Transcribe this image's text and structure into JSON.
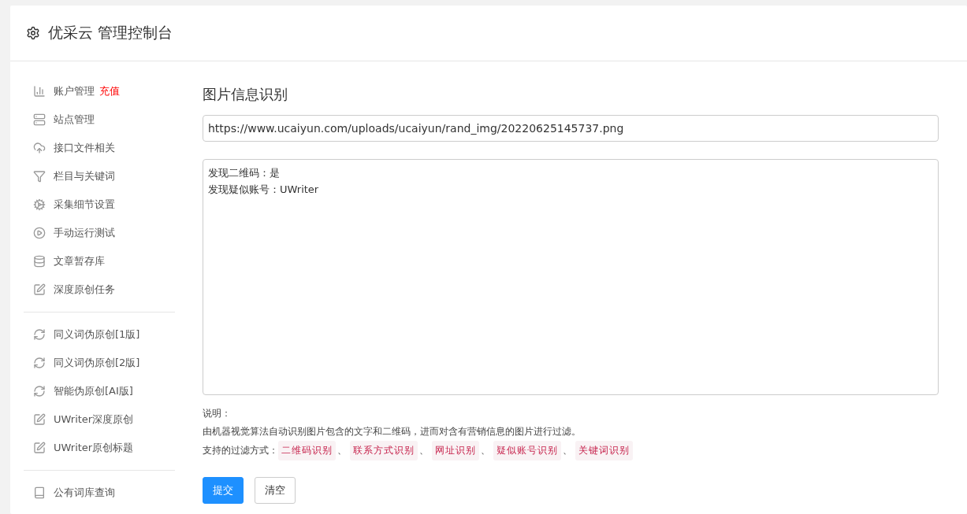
{
  "header": {
    "title": "优采云 管理控制台"
  },
  "sidebar": {
    "groups": [
      {
        "items": [
          {
            "kind": "chart",
            "label": "账户管理",
            "badge": "充值"
          },
          {
            "kind": "server",
            "label": "站点管理"
          },
          {
            "kind": "upload",
            "label": "接口文件相关"
          },
          {
            "kind": "filter",
            "label": "栏目与关键词"
          },
          {
            "kind": "cogs",
            "label": "采集细节设置"
          },
          {
            "kind": "play",
            "label": "手动运行测试"
          },
          {
            "kind": "database",
            "label": "文章暂存库"
          },
          {
            "kind": "edit",
            "label": "深度原创任务"
          }
        ]
      },
      {
        "items": [
          {
            "kind": "refresh",
            "label": "同义词伪原创[1版]"
          },
          {
            "kind": "refresh",
            "label": "同义词伪原创[2版]"
          },
          {
            "kind": "refresh",
            "label": "智能伪原创[AI版]"
          },
          {
            "kind": "edit",
            "label": "UWriter深度原创"
          },
          {
            "kind": "edit",
            "label": "UWriter原创标题"
          }
        ]
      },
      {
        "items": [
          {
            "kind": "book",
            "label": "公有词库查询"
          }
        ]
      }
    ]
  },
  "main": {
    "title": "图片信息识别",
    "url": "https://www.ucaiyun.com/uploads/ucaiyun/rand_img/20220625145737.png",
    "result": [
      "发现二维码：是",
      "发现疑似账号：UWriter"
    ],
    "notes_heading": "说明：",
    "description": "由机器视觉算法自动识别图片包含的文字和二维码，进而对含有营销信息的图片进行过滤。",
    "filters_label": "支持的过滤方式：",
    "filters": [
      "二维码识别",
      "联系方式识别",
      "网址识别",
      "疑似账号识别",
      "关键词识别"
    ],
    "separator": "、",
    "buttons": [
      {
        "kind": "primary",
        "label": "提交"
      },
      {
        "kind": "default",
        "label": "清空"
      }
    ]
  }
}
